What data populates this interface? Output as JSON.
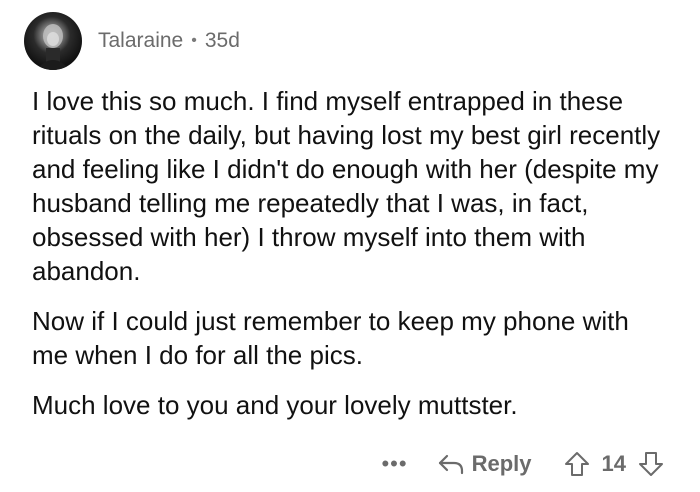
{
  "comment": {
    "author": "Talaraine",
    "separator": "•",
    "age": "35d",
    "paragraphs": [
      "I love this so much. I find myself entrapped in these rituals on the daily, but having lost my best girl recently and feeling like I didn't do enough with her (despite my husband telling me repeatedly that I was, in fact, obsessed with her) I throw myself into them with abandon.",
      "Now if I could just remember to keep my phone with me when I do for all the pics.",
      "Much love to you and your lovely muttster."
    ]
  },
  "actions": {
    "more_label": "•••",
    "reply_label": "Reply",
    "score": "14"
  },
  "icons": {
    "reply": "reply-arrow-icon",
    "upvote": "upvote-arrow-icon",
    "downvote": "downvote-arrow-icon"
  }
}
